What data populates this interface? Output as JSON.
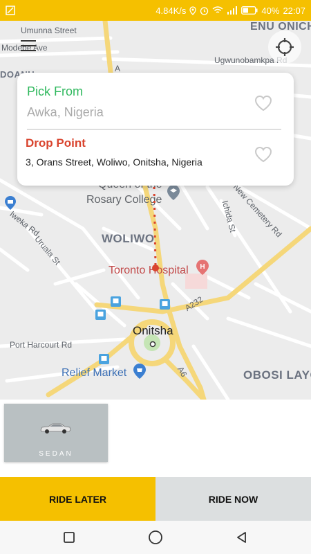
{
  "status_bar": {
    "speed": "4.84K/s",
    "battery": "40%",
    "time": "22:07"
  },
  "map": {
    "labels": {
      "umunna_street": "Umunna Street",
      "modebe_ave": "Modebe Ave",
      "enu_onicha": "ENU ONICH",
      "ugwunobamkpa": "Ugwunobamkpa Rd",
      "queen_rosary_1": "Queen of the",
      "queen_rosary_2": "Rosary College",
      "iweka_rd": "Iweka Rd",
      "uruala_st": "Uruala St",
      "ichida_st": "Ichida St",
      "new_cemetery": "New Cemetery Rd",
      "woliwo": "WOLIWO",
      "toronto_hospital": "Toronto Hospital",
      "onitsha": "Onitsha",
      "port_harcourt_rd": "Port Harcourt Rd",
      "relief_market": "Relief Market",
      "obosi": "OBOSI LAYO",
      "a232": "A232",
      "a6": "A6",
      "road_a": "A",
      "doanu": "DOANU"
    },
    "colors": {
      "road_major": "#f7dc7a",
      "road_minor": "#ffffff",
      "background": "#ececec",
      "route": "#d9442e"
    }
  },
  "location_card": {
    "pick_label": "Pick From",
    "pick_value": "Awka, Nigeria",
    "drop_label": "Drop Point",
    "drop_value": "3, Orans Street, Woliwo, Onitsha, Nigeria"
  },
  "vehicles": [
    {
      "label": "SEDAN",
      "icon": "sedan-car-icon"
    }
  ],
  "actions": {
    "ride_later": "RIDE LATER",
    "ride_now": "RIDE NOW"
  },
  "colors": {
    "accent": "#f5c000",
    "pick": "#2fb85d",
    "drop": "#d9442e"
  }
}
